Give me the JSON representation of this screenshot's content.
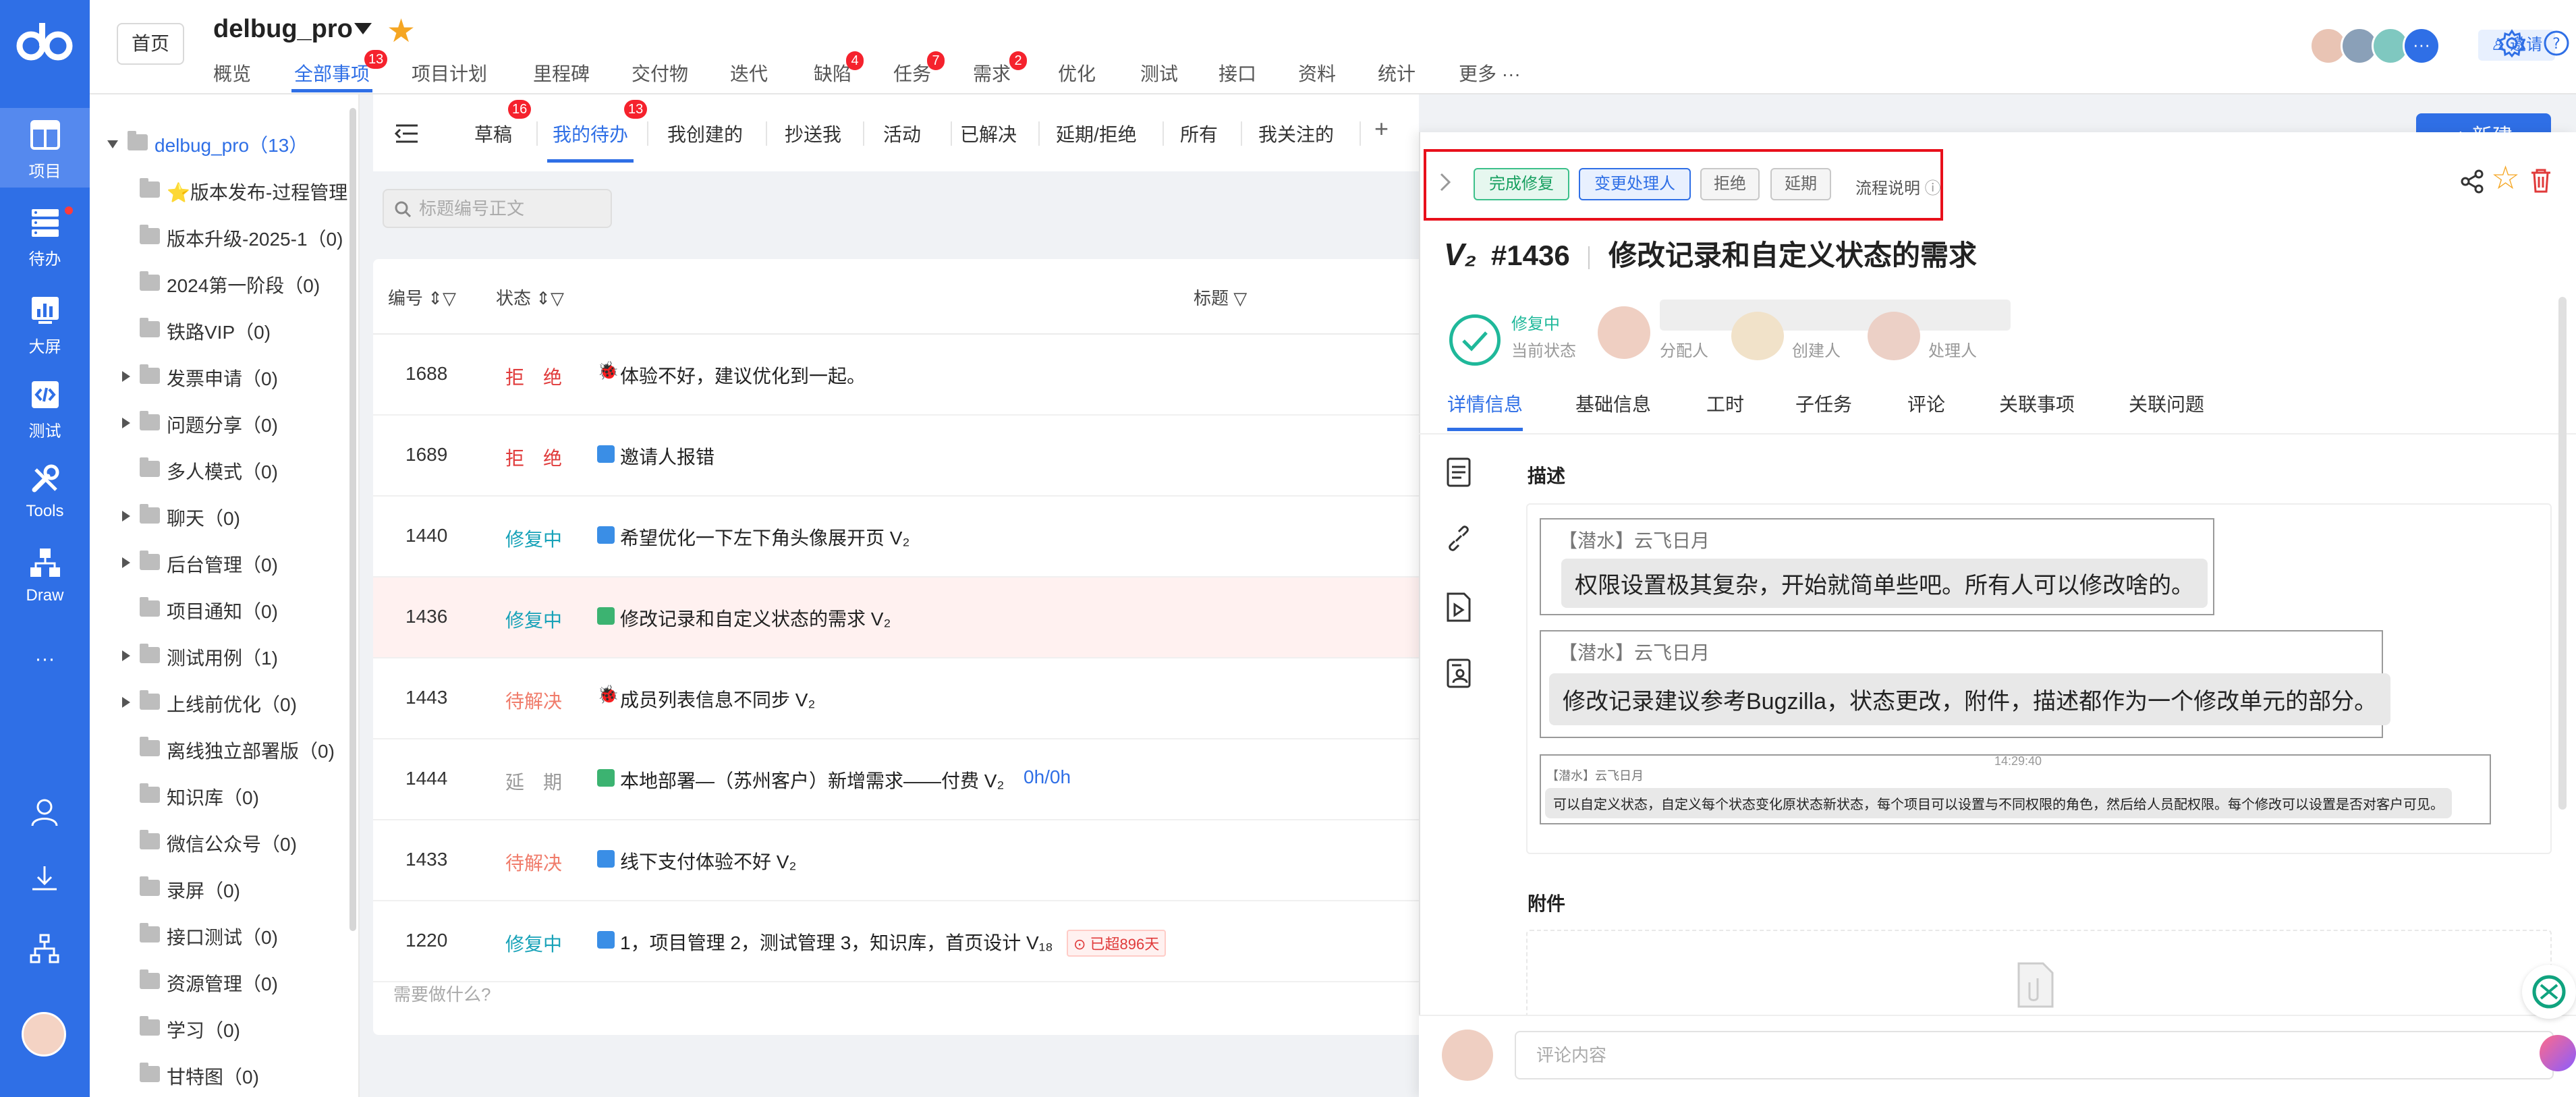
{
  "nav": {
    "items": [
      {
        "label": "项目"
      },
      {
        "label": "待办"
      },
      {
        "label": "大屏"
      },
      {
        "label": "测试"
      },
      {
        "label": "Tools"
      },
      {
        "label": "Draw"
      },
      {
        "label": "···"
      }
    ]
  },
  "header": {
    "home": "首页",
    "project": "delbug_pro",
    "invite": "邀请",
    "tabs": [
      {
        "label": "概览"
      },
      {
        "label": "全部事项",
        "badge": "13"
      },
      {
        "label": "项目计划"
      },
      {
        "label": "里程碑"
      },
      {
        "label": "交付物"
      },
      {
        "label": "迭代"
      },
      {
        "label": "缺陷",
        "badge": "4"
      },
      {
        "label": "任务",
        "badge": "7"
      },
      {
        "label": "需求",
        "badge": "2"
      },
      {
        "label": "优化"
      },
      {
        "label": "测试"
      },
      {
        "label": "接口"
      },
      {
        "label": "资料"
      },
      {
        "label": "统计"
      },
      {
        "label": "更多 ···"
      }
    ]
  },
  "sidebar": {
    "root": "delbug_pro（13）",
    "items": [
      {
        "label": "⭐版本发布-过程管理"
      },
      {
        "label": "版本升级-2025-1（0)"
      },
      {
        "label": "2024第一阶段（0)"
      },
      {
        "label": "铁路VIP（0)"
      },
      {
        "label": "发票申请（0)"
      },
      {
        "label": "问题分享（0)"
      },
      {
        "label": "多人模式（0)"
      },
      {
        "label": "聊天（0)"
      },
      {
        "label": "后台管理（0)"
      },
      {
        "label": "项目通知（0)"
      },
      {
        "label": "测试用例（1)"
      },
      {
        "label": "上线前优化（0)"
      },
      {
        "label": "离线独立部署版（0)"
      },
      {
        "label": "知识库（0)"
      },
      {
        "label": "微信公众号（0)"
      },
      {
        "label": "录屏（0)"
      },
      {
        "label": "接口测试（0)"
      },
      {
        "label": "资源管理（0)"
      },
      {
        "label": "学习（0)"
      },
      {
        "label": "甘特图（0)"
      }
    ]
  },
  "list": {
    "subtabs": [
      {
        "label": "草稿",
        "badge": "16"
      },
      {
        "label": "我的待办",
        "badge": "13"
      },
      {
        "label": "我创建的"
      },
      {
        "label": "抄送我"
      },
      {
        "label": "活动"
      },
      {
        "label": "已解决"
      },
      {
        "label": "延期/拒绝"
      },
      {
        "label": "所有"
      },
      {
        "label": "我关注的"
      },
      {
        "label": "+"
      }
    ],
    "search_placeholder": "标题编号正文",
    "columns": {
      "id": "编号",
      "status": "状态",
      "title": "标题"
    },
    "rows": [
      {
        "id": "1688",
        "status": "拒　绝",
        "title": "体验不好，建议优化到一起。",
        "color": "#e03a3a",
        "icon": "bug"
      },
      {
        "id": "1689",
        "status": "拒　绝",
        "title": "邀请人报错",
        "color": "#e03a3a",
        "icon": "task"
      },
      {
        "id": "1440",
        "status": "修复中",
        "title": "希望优化一下左下角头像展开页 V₂",
        "color": "#17a2b8",
        "icon": "task"
      },
      {
        "id": "1436",
        "status": "修复中",
        "title": "修改记录和自定义状态的需求 V₂",
        "color": "#17a2b8",
        "icon": "story"
      },
      {
        "id": "1443",
        "status": "待解决",
        "title": "成员列表信息不同步 V₂",
        "color": "#f07c6b",
        "icon": "bug"
      },
      {
        "id": "1444",
        "status": "延　期",
        "title": "本地部署—（苏州客户）新增需求——付费 V₂",
        "extra": "0h/0h",
        "color": "#999999",
        "icon": "story"
      },
      {
        "id": "1433",
        "status": "待解决",
        "title": "线下支付体验不好 V₂",
        "color": "#f07c6b",
        "icon": "task"
      },
      {
        "id": "1220",
        "status": "修复中",
        "title": "1，项目管理 2，测试管理 3，知识库，首页设计 V₁₈",
        "extra": "已超896天",
        "color": "#17a2b8",
        "icon": "task"
      }
    ],
    "hint": "需要做什么?"
  },
  "detail": {
    "new_button": "+ 新建",
    "actions": {
      "fix": "完成修复",
      "reassign": "变更处理人",
      "reject": "拒绝",
      "delay": "延期",
      "flow": "流程说明"
    },
    "issue_no": "#1436",
    "title": "修改记录和自定义状态的需求",
    "status": "修复中",
    "status_label": "当前状态",
    "roles": {
      "assign": "分配人",
      "creator": "创建人",
      "handler": "处理人"
    },
    "tabs": [
      {
        "label": "详情信息"
      },
      {
        "label": "基础信息"
      },
      {
        "label": "工时"
      },
      {
        "label": "子任务"
      },
      {
        "label": "评论"
      },
      {
        "label": "关联事项"
      },
      {
        "label": "关联问题"
      }
    ],
    "desc_label": "描述",
    "comments": [
      {
        "name": "【潜水】云飞日月",
        "text": "权限设置极其复杂，开始就简单些吧。所有人可以修改啥的。"
      },
      {
        "name": "【潜水】云飞日月",
        "text": "修改记录建议参考Bugzilla，状态更改，附件，描述都作为一个修改单元的部分。"
      },
      {
        "name": "【潜水】云飞日月",
        "time": "14:29:40",
        "text": "可以自定义状态，自定义每个状态变化原状态新状态，每个项目可以设置与不同权限的角色，然后给人员配权限。每个修改可以设置是否对客户可见。"
      }
    ],
    "attach_label": "附件",
    "comment_placeholder": "评论内容"
  },
  "colors": {
    "accent": "#2f6fe6",
    "danger": "#e8101b",
    "fixing": "#17a2b8",
    "success": "#1fb89a"
  }
}
